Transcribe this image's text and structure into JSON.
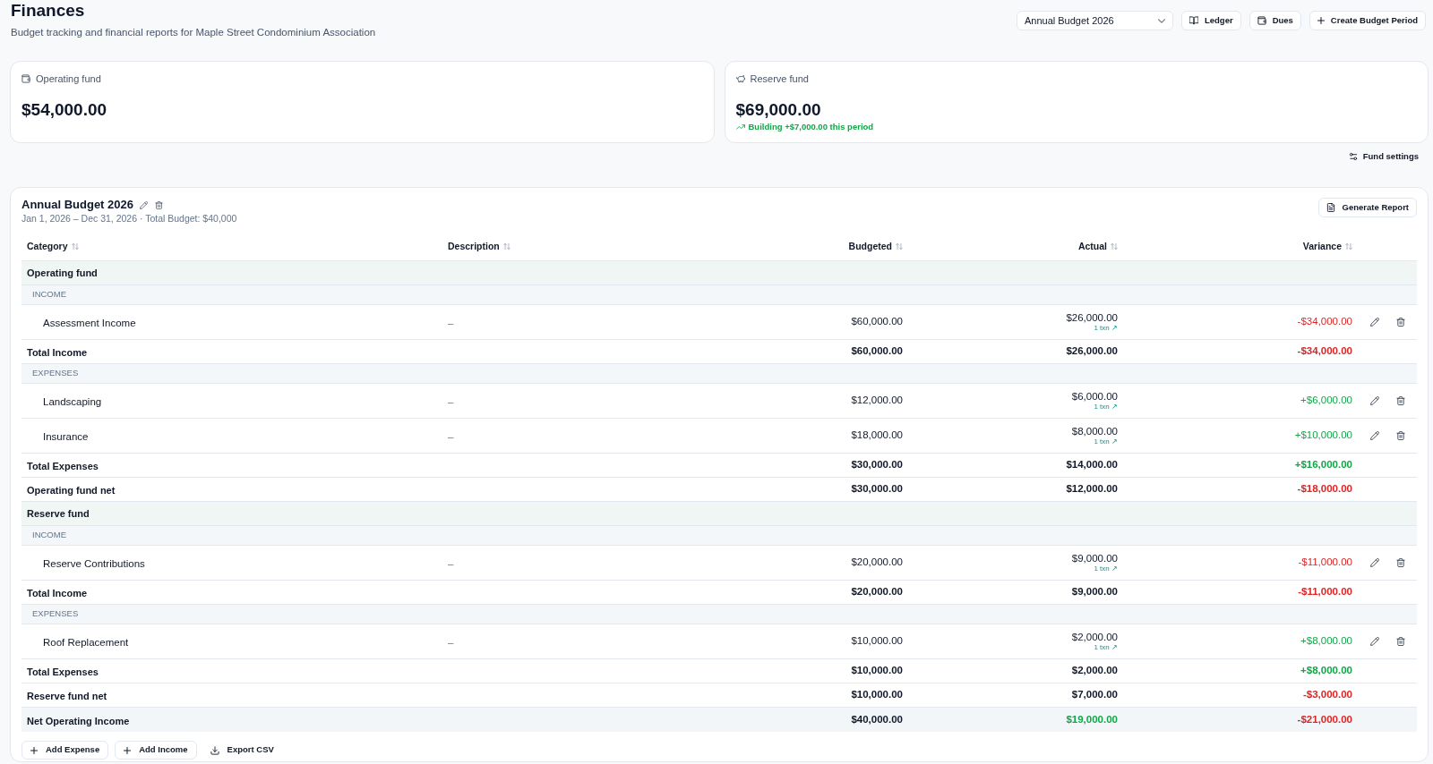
{
  "header": {
    "title": "Finances",
    "subtitle": "Budget tracking and financial reports for Maple Street Condominium Association"
  },
  "toolbar": {
    "period_select": {
      "value": "Annual Budget 2026"
    },
    "ledger_button": "Ledger",
    "dues_button": "Dues",
    "create_period_button": "Create Budget Period"
  },
  "fund_cards": [
    {
      "kind": "operating",
      "label": "Operating fund",
      "amount": "$54,000.00"
    },
    {
      "kind": "reserve",
      "label": "Reserve fund",
      "amount": "$69,000.00",
      "trend": "Building +$7,000.00 this period"
    }
  ],
  "fund_settings_button": "Fund settings",
  "budget": {
    "title": "Annual Budget 2026",
    "period_info": "Jan 1, 2026 – Dec 31, 2026 · Total Budget: $40,000",
    "generate_report_button": "Generate Report",
    "table": {
      "columns": [
        "Category",
        "Description",
        "Budgeted",
        "Actual",
        "Variance"
      ],
      "funds": [
        {
          "label": "Operating fund",
          "sections": [
            {
              "label": "INCOME",
              "items": [
                {
                  "category": "Assessment Income",
                  "description": "–",
                  "budgeted": "$60,000.00",
                  "actual": "$26,000.00",
                  "transactions": "1 txn ↗",
                  "variance": "-$34,000.00",
                  "favorable": false
                }
              ],
              "total": {
                "label": "Total Income",
                "budgeted": "$60,000.00",
                "actual": "$26,000.00",
                "variance": "-$34,000.00",
                "favorable": false
              }
            },
            {
              "label": "EXPENSES",
              "items": [
                {
                  "category": "Landscaping",
                  "description": "–",
                  "budgeted": "$12,000.00",
                  "actual": "$6,000.00",
                  "transactions": "1 txn ↗",
                  "variance": "+$6,000.00",
                  "favorable": true
                },
                {
                  "category": "Insurance",
                  "description": "–",
                  "budgeted": "$18,000.00",
                  "actual": "$8,000.00",
                  "transactions": "1 txn ↗",
                  "variance": "+$10,000.00",
                  "favorable": true
                }
              ],
              "total": {
                "label": "Total Expenses",
                "budgeted": "$30,000.00",
                "actual": "$14,000.00",
                "variance": "+$16,000.00",
                "favorable": true
              }
            }
          ],
          "net": {
            "label": "Operating fund net",
            "budgeted": "$30,000.00",
            "actual": "$12,000.00",
            "variance": "-$18,000.00",
            "favorable": false
          }
        },
        {
          "label": "Reserve fund",
          "sections": [
            {
              "label": "INCOME",
              "items": [
                {
                  "category": "Reserve Contributions",
                  "description": "–",
                  "budgeted": "$20,000.00",
                  "actual": "$9,000.00",
                  "transactions": "1 txn ↗",
                  "variance": "-$11,000.00",
                  "favorable": false
                }
              ],
              "total": {
                "label": "Total Income",
                "budgeted": "$20,000.00",
                "actual": "$9,000.00",
                "variance": "-$11,000.00",
                "favorable": false
              }
            },
            {
              "label": "EXPENSES",
              "items": [
                {
                  "category": "Roof Replacement",
                  "description": "–",
                  "budgeted": "$10,000.00",
                  "actual": "$2,000.00",
                  "transactions": "1 txn ↗",
                  "variance": "+$8,000.00",
                  "favorable": true
                }
              ],
              "total": {
                "label": "Total Expenses",
                "budgeted": "$10,000.00",
                "actual": "$2,000.00",
                "variance": "+$8,000.00",
                "favorable": true
              }
            }
          ],
          "net": {
            "label": "Reserve fund net",
            "budgeted": "$10,000.00",
            "actual": "$7,000.00",
            "variance": "-$3,000.00",
            "favorable": false
          }
        }
      ],
      "grand_total": {
        "label": "Net Operating Income",
        "budgeted": "$40,000.00",
        "actual": "$19,000.00",
        "actual_highlighted": true,
        "variance": "-$21,000.00",
        "favorable": false
      }
    },
    "footer_buttons": {
      "add_expense": "Add Expense",
      "add_income": "Add Income",
      "export_csv": "Export CSV"
    }
  }
}
